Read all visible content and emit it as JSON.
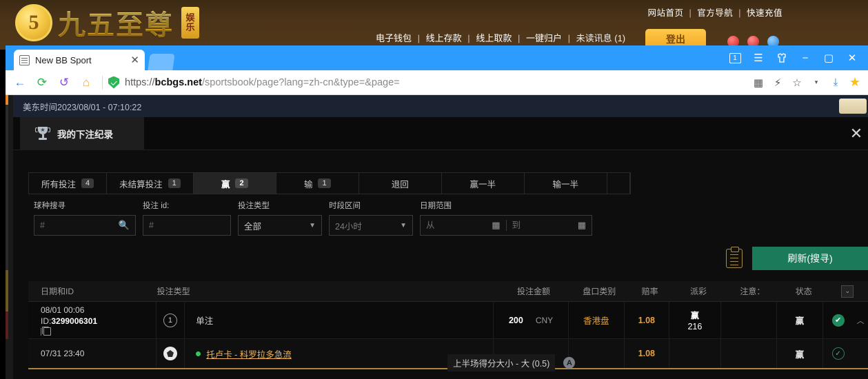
{
  "site": {
    "logo_coin": "5",
    "logo_text": "九五至尊",
    "logo_badge_top": "娱",
    "logo_badge_bottom": "乐",
    "topnav": [
      "网站首页",
      "官方导航",
      "快速充值"
    ],
    "subnav": [
      "电子钱包",
      "线上存款",
      "线上取款",
      "一键归户",
      "未读讯息 (1)"
    ],
    "login_button": "登出"
  },
  "browser": {
    "tab_title": "New BB Sport",
    "tab_close": "✕",
    "window_badge": "1",
    "url_proto": "https://",
    "url_host": "bcbgs.net",
    "url_path": "/sportsbook/page?lang=zh-cn&type=&page="
  },
  "page": {
    "time_text": "美东时间2023/08/01 - 07:10:22",
    "panel_title": "我的下注纪录",
    "panel_close": "✕"
  },
  "status_tabs": [
    {
      "label": "所有投注",
      "count": "4",
      "active": false
    },
    {
      "label": "未结算投注",
      "count": "1",
      "active": false
    },
    {
      "label": "赢",
      "count": "2",
      "active": true
    },
    {
      "label": "输",
      "count": "1",
      "active": false
    },
    {
      "label": "退回",
      "count": "",
      "active": false
    },
    {
      "label": "赢一半",
      "count": "",
      "active": false
    },
    {
      "label": "输一半",
      "count": "",
      "active": false
    }
  ],
  "filters": {
    "sport_search": {
      "label": "球种搜寻",
      "value": "",
      "placeholder": "#"
    },
    "bet_id": {
      "label": "投注 id:",
      "value": "",
      "placeholder": "#"
    },
    "bet_type": {
      "label": "投注类型",
      "selected": "全部"
    },
    "period": {
      "label": "时段区间",
      "selected": "24小时"
    },
    "date_range": {
      "label": "日期范围",
      "from_placeholder": "从",
      "to_placeholder": "到",
      "from_value": "",
      "to_value": ""
    }
  },
  "refresh": {
    "label": "刷新(搜寻)"
  },
  "table": {
    "headers": {
      "date_id": "日期和ID",
      "bet_type": "投注类型",
      "stake": "投注金额",
      "market": "盘口类别",
      "odds": "赔率",
      "payout": "派彩",
      "note": "注意：",
      "status": "状态",
      "sort": "⌄"
    },
    "rows": [
      {
        "kind": "main",
        "date": "08/01 00:06",
        "id_prefix": "ID:",
        "id": "3299006301",
        "leg_number": "1",
        "bet_type": "单注",
        "stake_amount": "200",
        "currency": "CNY",
        "market": "香港盘",
        "odds": "1.08",
        "payout_label": "赢",
        "payout_value": "216",
        "note": "",
        "status": "赢",
        "check": "✔",
        "collapse": "︿"
      },
      {
        "kind": "sub",
        "date": "07/31 23:40",
        "match": "托卢卡 - 科罗拉多急流",
        "selection": "上半场得分大小 - 大 (0.5)",
        "info": "A",
        "stake_amount": "",
        "currency": "",
        "market": "",
        "odds": "1.08",
        "payout_label": "",
        "payout_value": "",
        "note": "",
        "status": "赢",
        "check": "✓"
      }
    ]
  },
  "colors": {
    "accent_green": "#1b7a5a",
    "accent_orange": "#e8a33c",
    "browser_blue": "#2d9cff",
    "panel_bg": "#0d0d0d"
  }
}
